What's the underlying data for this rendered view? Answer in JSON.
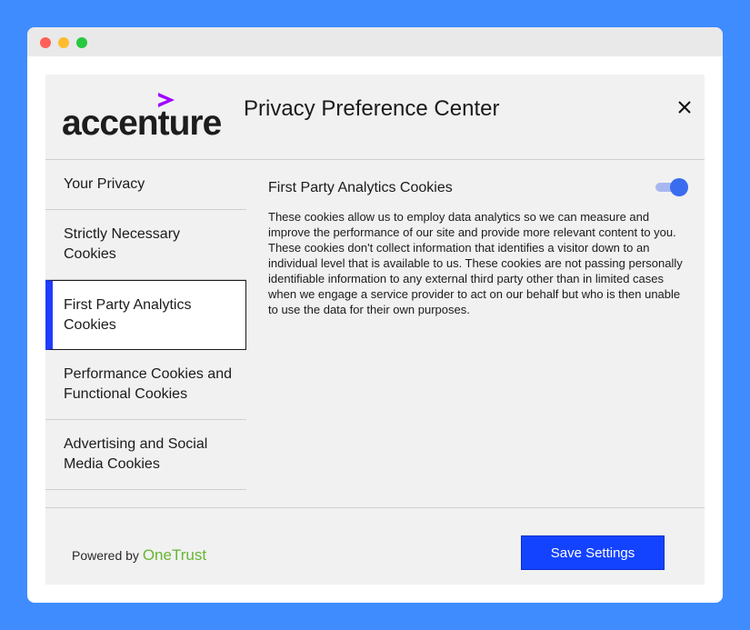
{
  "window": {
    "controls": [
      "close",
      "minimize",
      "maximize"
    ]
  },
  "header": {
    "logo_text": "accenture",
    "title": "Privacy Preference Center",
    "close_icon": "close-icon"
  },
  "sidebar": {
    "items": [
      {
        "label": "Your Privacy"
      },
      {
        "label": "Strictly Necessary Cookies"
      },
      {
        "label": "First Party Analytics Cookies"
      },
      {
        "label": "Performance Cookies and Functional Cookies"
      },
      {
        "label": "Advertising and Social Media Cookies"
      }
    ],
    "active_index": 2
  },
  "content": {
    "title": "First Party Analytics Cookies",
    "toggle_on": true,
    "description": "These cookies allow us to employ data analytics so we can measure and improve the performance of our site and provide more relevant content to you. These cookies don't collect information that identifies a visitor down to an individual level that is available to us. These cookies are not passing personally identifiable information to any external third party other than in limited cases when we engage a service provider to act on our behalf but who is then unable to use the data for their own purposes."
  },
  "footer": {
    "powered_by": "Powered by",
    "brand": "OneTrust",
    "save_label": "Save Settings"
  },
  "colors": {
    "accent": "#1443ff",
    "brand_purple": "#a100ff",
    "onetrust_green": "#68b631"
  }
}
